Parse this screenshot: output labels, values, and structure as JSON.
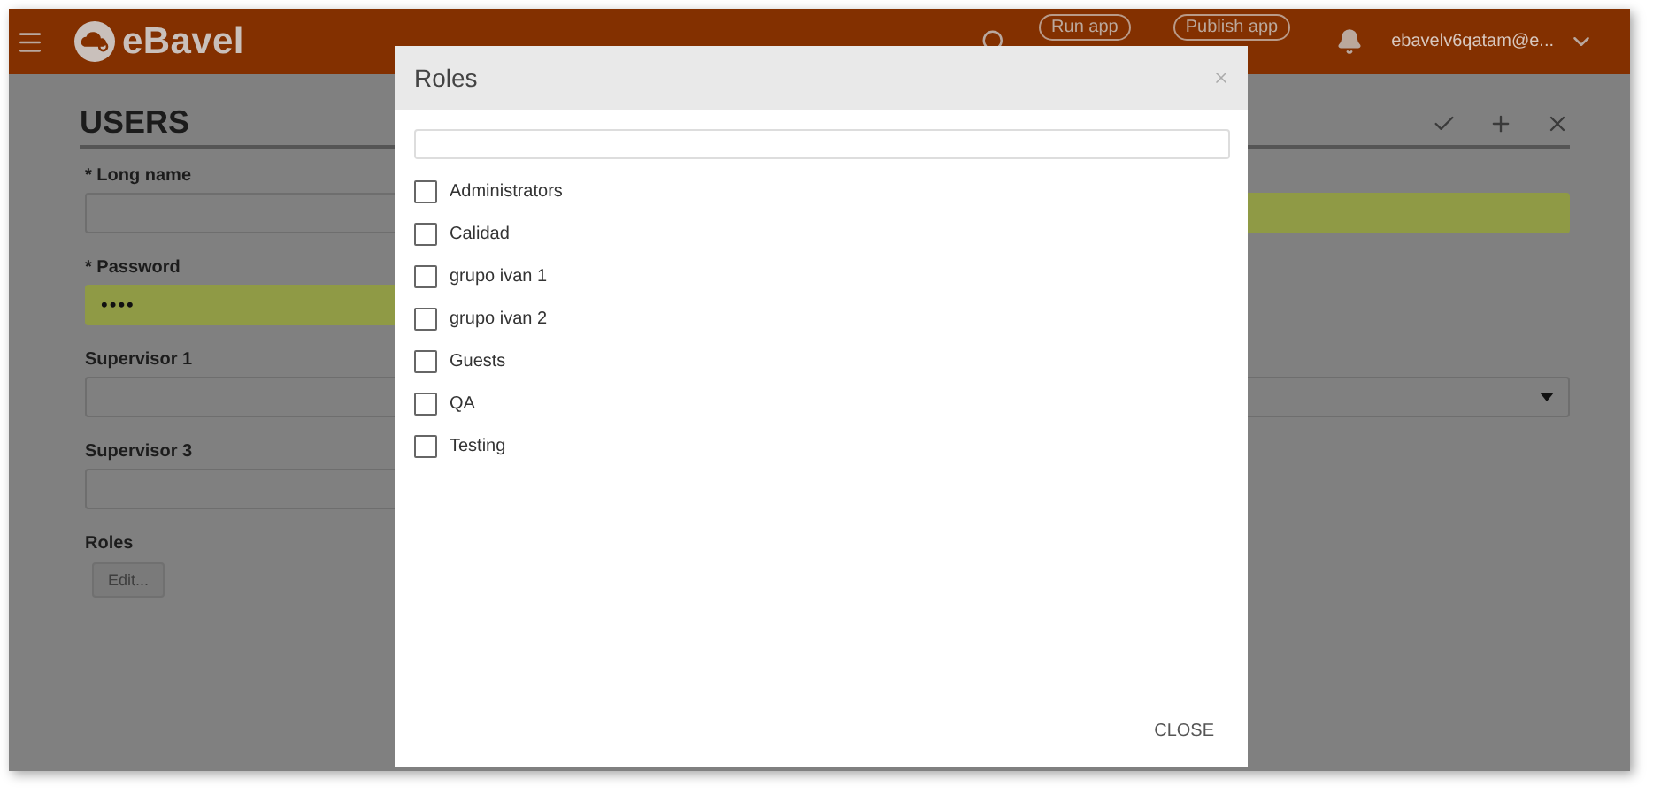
{
  "header": {
    "brand": "eBavel",
    "run_app": "Run app",
    "publish_app": "Publish app",
    "user": "ebavelv6qatam@e..."
  },
  "page": {
    "title": "USERS",
    "left_fields": [
      {
        "label": "* Long name",
        "kind": "text",
        "highlighted": false
      },
      {
        "label": "* Password",
        "kind": "password",
        "value": "••••",
        "highlighted": true
      },
      {
        "label": "Supervisor 1",
        "kind": "text",
        "highlighted": false
      },
      {
        "label": "Supervisor 3",
        "kind": "text",
        "highlighted": false
      }
    ],
    "right_fields": [
      {
        "kind": "text",
        "highlighted": true
      },
      {
        "kind": "empty"
      },
      {
        "kind": "select",
        "highlighted": false
      },
      {
        "kind": "empty"
      }
    ],
    "roles": {
      "label": "Roles",
      "button": "Edit..."
    }
  },
  "modal": {
    "title": "Roles",
    "close_label": "CLOSE",
    "options": [
      {
        "label": "Administrators",
        "checked": false
      },
      {
        "label": "Calidad",
        "checked": false
      },
      {
        "label": "grupo ivan 1",
        "checked": false
      },
      {
        "label": "grupo ivan 2",
        "checked": false
      },
      {
        "label": "Guests",
        "checked": false
      },
      {
        "label": "QA",
        "checked": false
      },
      {
        "label": "Testing",
        "checked": false
      }
    ]
  }
}
